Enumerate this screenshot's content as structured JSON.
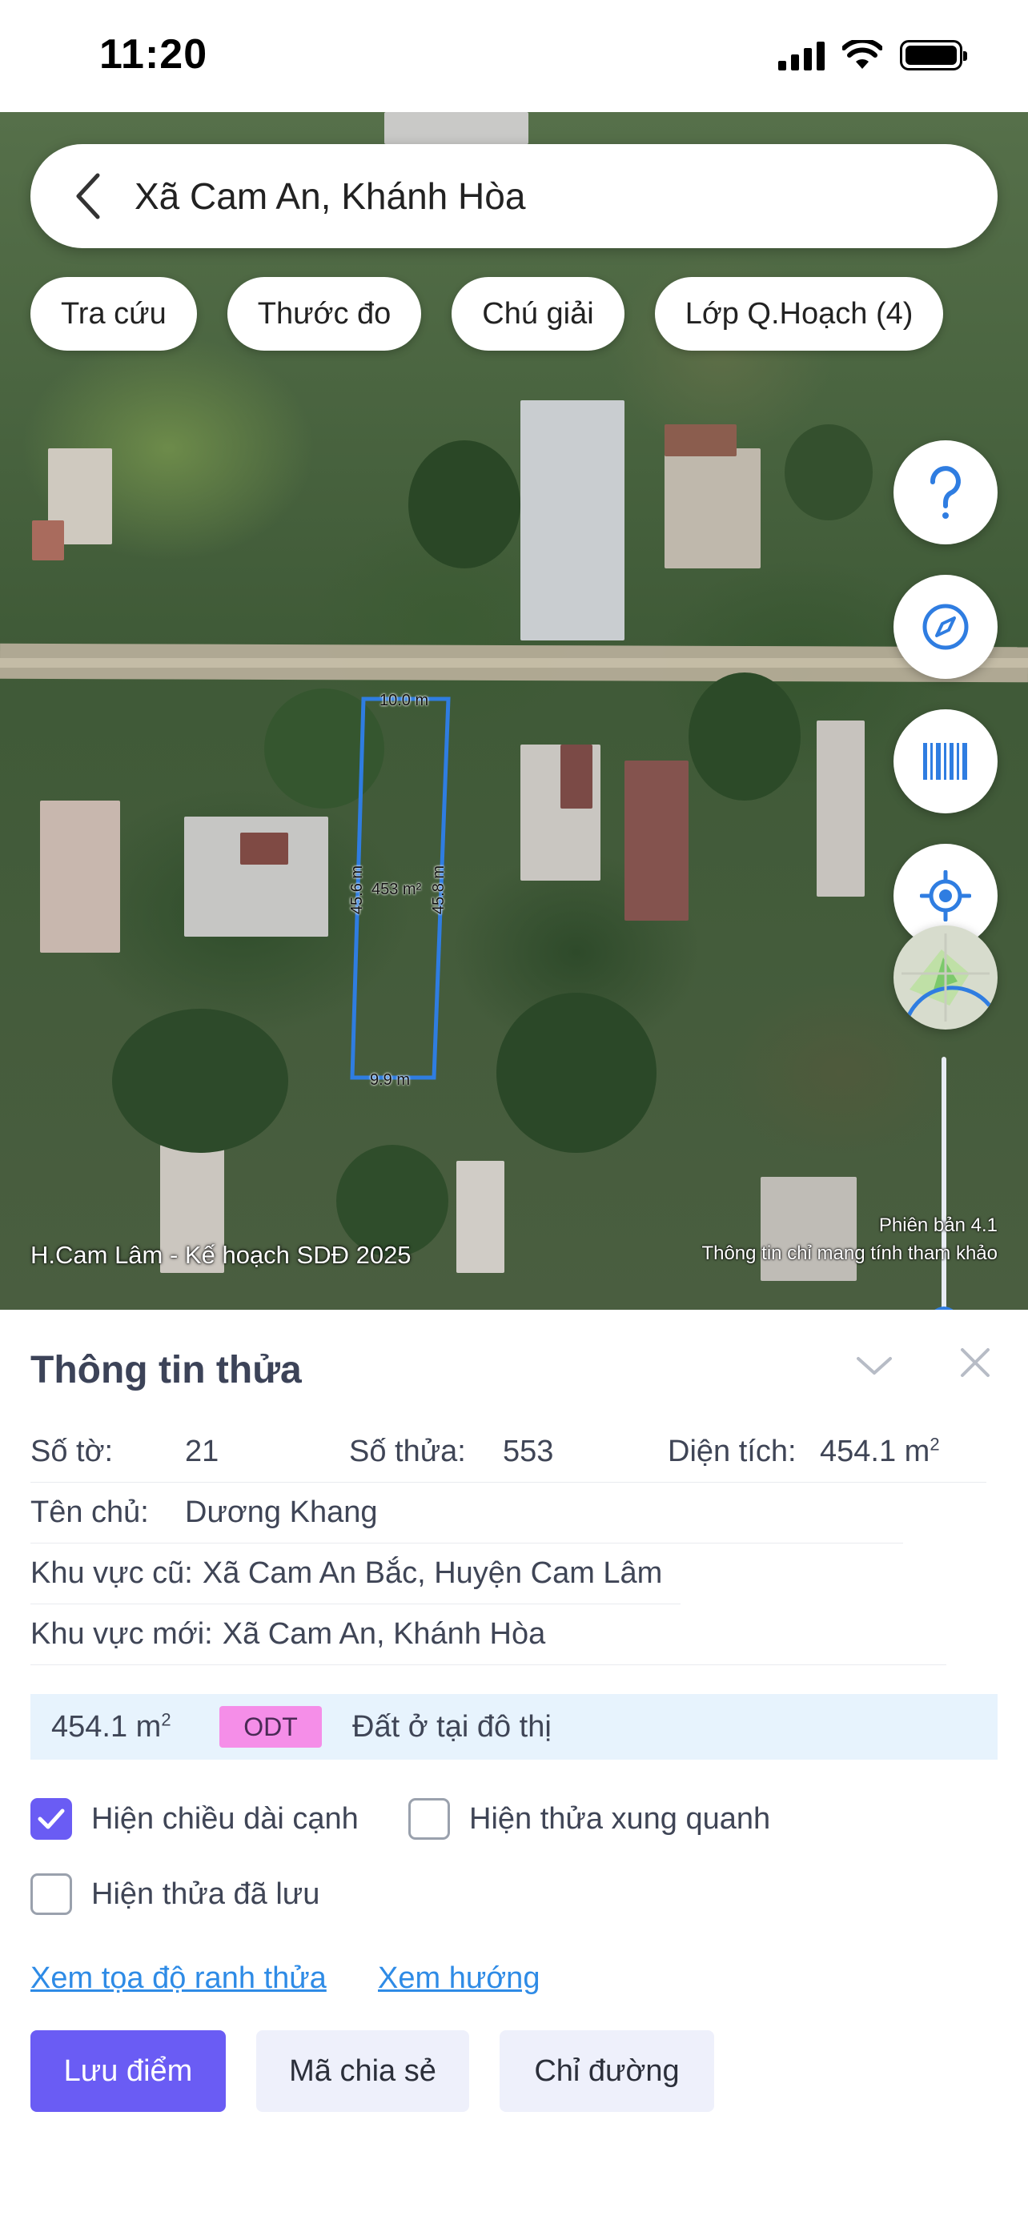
{
  "status_bar": {
    "time": "11:20"
  },
  "search": {
    "text": "Xã Cam An, Khánh Hòa"
  },
  "chips": [
    "Tra cứu",
    "Thước đo",
    "Chú giải",
    "Lớp Q.Hoạch (4)"
  ],
  "map": {
    "parcel": {
      "top_length": "10.0 m",
      "bottom_length": "9.9 m",
      "left_length": "45.6 m",
      "right_length": "45.8 m",
      "area_label": "453 m²",
      "outline_color": "#2f7de1"
    },
    "caption": "H.Cam Lâm - Kế hoạch SDĐ 2025",
    "version": "Phiên bản 4.1",
    "disclaimer": "Thông tin chỉ mang tính tham khảo"
  },
  "fab_icons": [
    "help-icon",
    "compass-icon",
    "barcode-icon",
    "locate-icon",
    "minimap"
  ],
  "sheet": {
    "title": "Thông tin thửa",
    "so_to_label": "Số tờ:",
    "so_to_value": "21",
    "so_thua_label": "Số thửa:",
    "so_thua_value": "553",
    "dien_tich_label": "Diện tích:",
    "dien_tich_value": "454.1 m",
    "ten_chu_label": "Tên chủ:",
    "ten_chu_value": "Dương Khang",
    "khu_vuc_cu_label": "Khu vực cũ:",
    "khu_vuc_cu_value": "Xã Cam An Bắc, Huyện Cam Lâm",
    "khu_vuc_moi_label": "Khu vực mới:",
    "khu_vuc_moi_value": "Xã Cam An, Khánh Hòa",
    "land_area": "454.1 m",
    "land_code": "ODT",
    "land_desc": "Đất ở tại đô thị",
    "unit_sup": "2",
    "land_code_color": "#f58ee8",
    "check_edge": {
      "label": "Hiện chiều dài cạnh",
      "checked": true
    },
    "check_around": {
      "label": "Hiện thửa xung quanh",
      "checked": false
    },
    "check_saved": {
      "label": "Hiện thửa đã lưu",
      "checked": false
    },
    "link_coords": "Xem tọa độ ranh thửa",
    "link_direction": "Xem hướng",
    "btn_save": "Lưu điểm",
    "btn_share": "Mã chia sẻ",
    "btn_route": "Chỉ đường",
    "accent_color": "#6a5cf4",
    "link_color": "#2e8be6"
  }
}
